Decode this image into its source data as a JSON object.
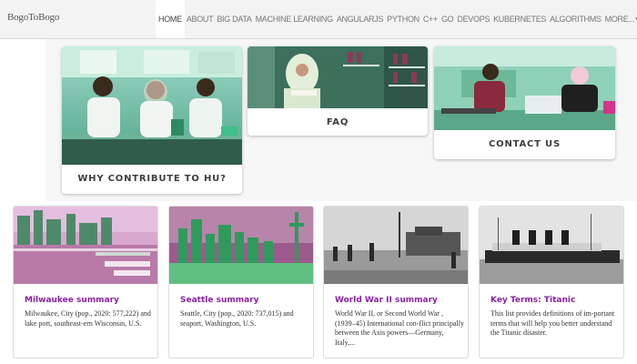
{
  "site": {
    "brand": "BogoToBogo"
  },
  "nav": {
    "items": [
      "HOME",
      "ABOUT",
      "BIG DATA",
      "MACHINE LEARNING",
      "ANGULARJS",
      "PYTHON",
      "C++",
      "GO",
      "DEVOPS",
      "KUBERNETES",
      "ALGORITHMS",
      "MORE..."
    ],
    "active": "HOME"
  },
  "hero": {
    "tiles": [
      {
        "caption": "WHY CONTRIBUTE TO HU?"
      },
      {
        "caption": "FAQ"
      },
      {
        "caption": "CONTACT US"
      }
    ]
  },
  "cards": [
    {
      "title": "Milwaukee summary",
      "text": "Milwaukee, City (pop., 2020: 577,222) and lake port, southeast-ern Wisconsin, U.S."
    },
    {
      "title": "Seattle summary",
      "text": "Seattle, City (pop., 2020: 737,015) and seaport, Washington, U.S."
    },
    {
      "title": "World War II summary",
      "text": "World War II, or Second World War , (1939–45) International con-flict principally between the Axis powers—Germany, Italy,..."
    },
    {
      "title": "Key Terms: Titanic",
      "text": "This list provides definitions of im-portant terms that will help you better understand the Titanic disaster."
    }
  ]
}
